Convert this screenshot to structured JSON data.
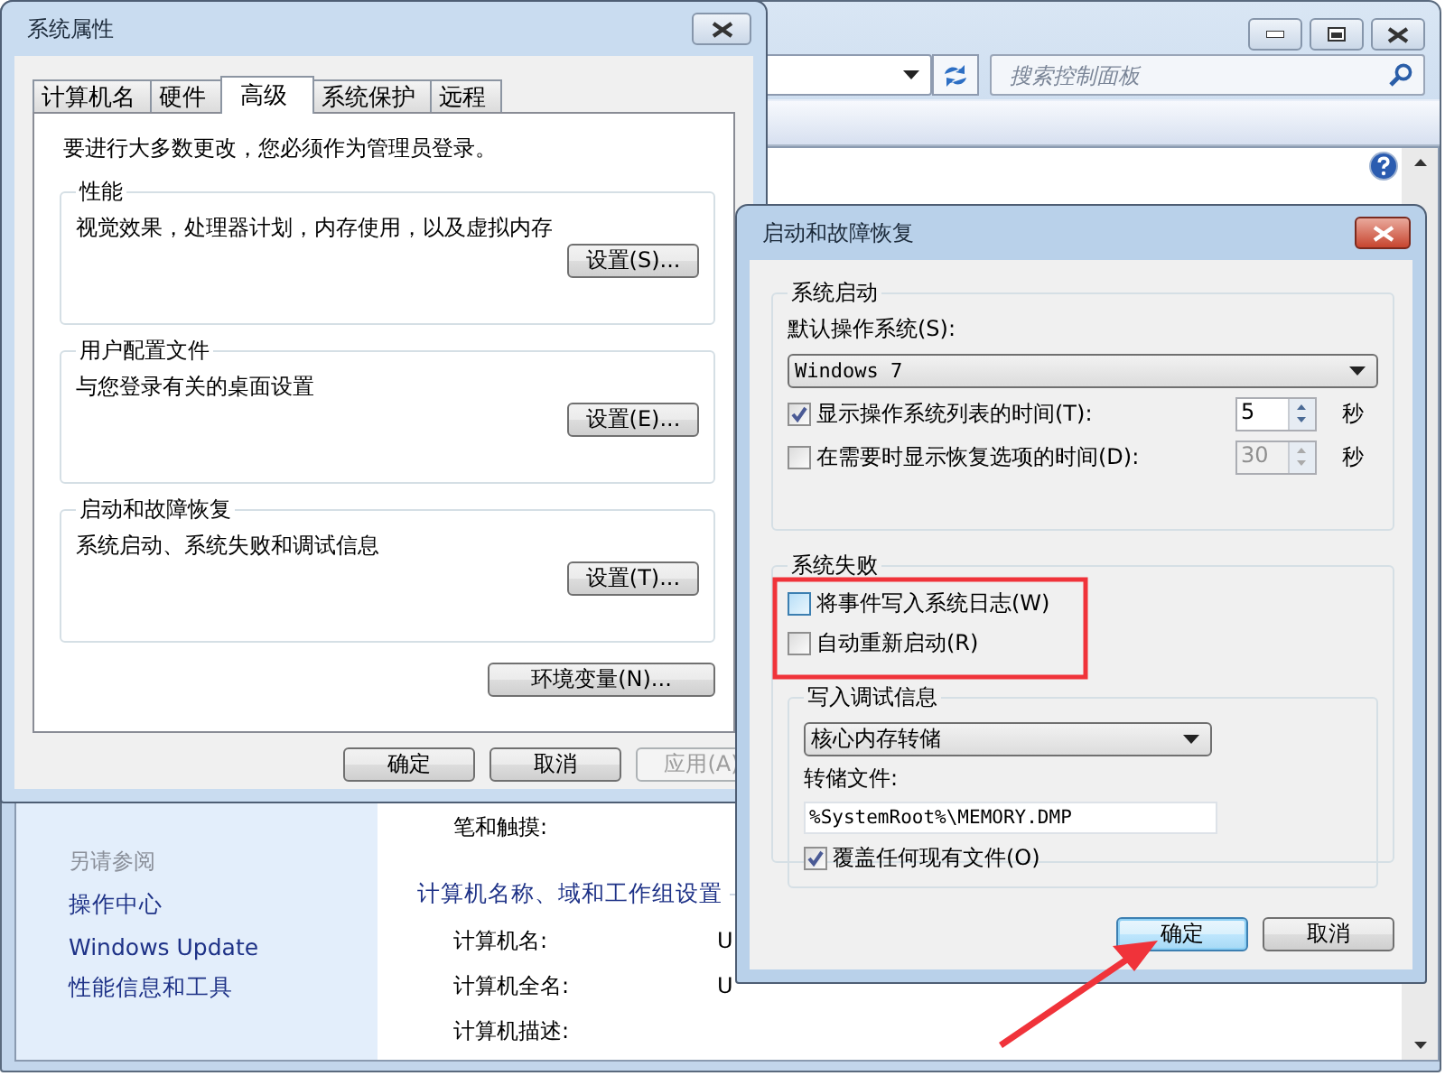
{
  "control_panel": {
    "search": {
      "placeholder": "搜索控制面板"
    },
    "see_also": {
      "heading": "另请参阅",
      "links": [
        "操作中心",
        "Windows Update",
        "性能信息和工具"
      ]
    },
    "pen_label": "笔和触摸:",
    "section": "计算机名称、域和工作组设置",
    "rows": [
      {
        "label": "计算机名:",
        "value": "U"
      },
      {
        "label": "计算机全名:",
        "value": "U"
      },
      {
        "label": "计算机描述:"
      }
    ]
  },
  "system_properties": {
    "title": "系统属性",
    "tabs": [
      {
        "label": "计算机名",
        "selected": false
      },
      {
        "label": "硬件",
        "selected": false
      },
      {
        "label": "高级",
        "selected": true
      },
      {
        "label": "系统保护",
        "selected": false
      },
      {
        "label": "远程",
        "selected": false
      }
    ],
    "notice": "要进行大多数更改，您必须作为管理员登录。",
    "groups": [
      {
        "title": "性能",
        "description": "视觉效果，处理器计划，内存使用，以及虚拟内存",
        "button": "设置(S)..."
      },
      {
        "title": "用户配置文件",
        "description": "与您登录有关的桌面设置",
        "button": "设置(E)..."
      },
      {
        "title": "启动和故障恢复",
        "description": "系统启动、系统失败和调试信息",
        "button": "设置(T)..."
      }
    ],
    "env_button": "环境变量(N)...",
    "buttons": [
      {
        "label": "确定",
        "disabled": false
      },
      {
        "label": "取消",
        "disabled": false
      },
      {
        "label": "应用(A)",
        "disabled": true
      }
    ]
  },
  "startup_recovery": {
    "title": "启动和故障恢复",
    "startup": {
      "title": "系统启动",
      "default_os_label": "默认操作系统(S):",
      "default_os": "Windows 7",
      "options": [
        {
          "label": "显示操作系统列表的时间(T):",
          "checked": true,
          "value": "5",
          "unit": "秒",
          "disabled": false
        },
        {
          "label": "在需要时显示恢复选项的时间(D):",
          "checked": false,
          "value": "30",
          "unit": "秒",
          "disabled": true
        }
      ]
    },
    "failure": {
      "title": "系统失败",
      "options": [
        {
          "label": "将事件写入系统日志(W)",
          "checked": false,
          "hovered": true
        },
        {
          "label": "自动重新启动(R)",
          "checked": false,
          "hovered": false
        }
      ],
      "debug": {
        "title": "写入调试信息",
        "type": "核心内存转储",
        "file_label": "转储文件:",
        "file": "%SystemRoot%\\MEMORY.DMP",
        "overwrite": {
          "label": "覆盖任何现有文件(O)",
          "checked": true
        }
      }
    },
    "buttons": [
      {
        "label": "确定",
        "default": true
      },
      {
        "label": "取消",
        "default": false
      }
    ]
  }
}
